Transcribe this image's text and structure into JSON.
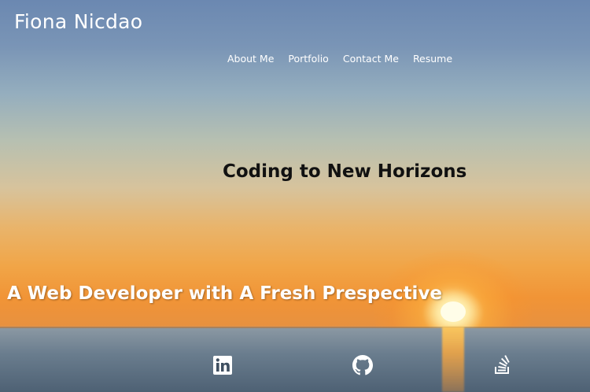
{
  "header": {
    "brand_name": "Fiona Nicdao"
  },
  "nav": {
    "items": [
      {
        "label": "About Me"
      },
      {
        "label": "Portfolio"
      },
      {
        "label": "Contact Me"
      },
      {
        "label": "Resume"
      }
    ]
  },
  "hero": {
    "headline": "Coding to New Horizons",
    "tagline": "A Web Developer with A Fresh Prespective"
  },
  "social_links": [
    {
      "icon": "linkedin-icon"
    },
    {
      "icon": "github-icon"
    },
    {
      "icon": "stack-overflow-icon"
    }
  ],
  "colors": {
    "text_light": "#ffffff",
    "headline_text": "#111111"
  }
}
